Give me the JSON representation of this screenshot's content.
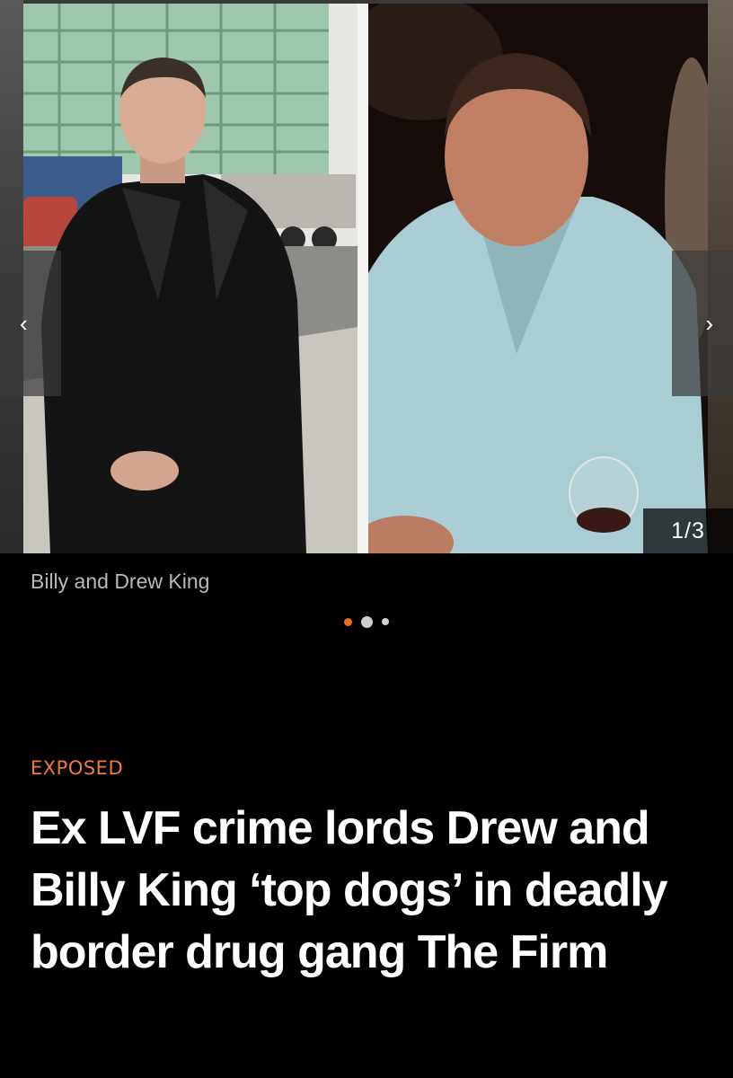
{
  "gallery": {
    "counter": "1/3",
    "caption": "Billy and Drew King",
    "prev_icon": "chevron-left-icon",
    "next_icon": "chevron-right-icon",
    "current_index": 1,
    "total": 3,
    "prev_glyph": "‹",
    "next_glyph": "›"
  },
  "article": {
    "kicker": "EXPOSED",
    "headline": "Ex LVF crime lords Drew and Billy King ‘top dogs’ in deadly border drug gang The Firm"
  },
  "colors": {
    "accent": "#f06a1d",
    "background": "#000000",
    "caption": "#b9b9b9"
  }
}
